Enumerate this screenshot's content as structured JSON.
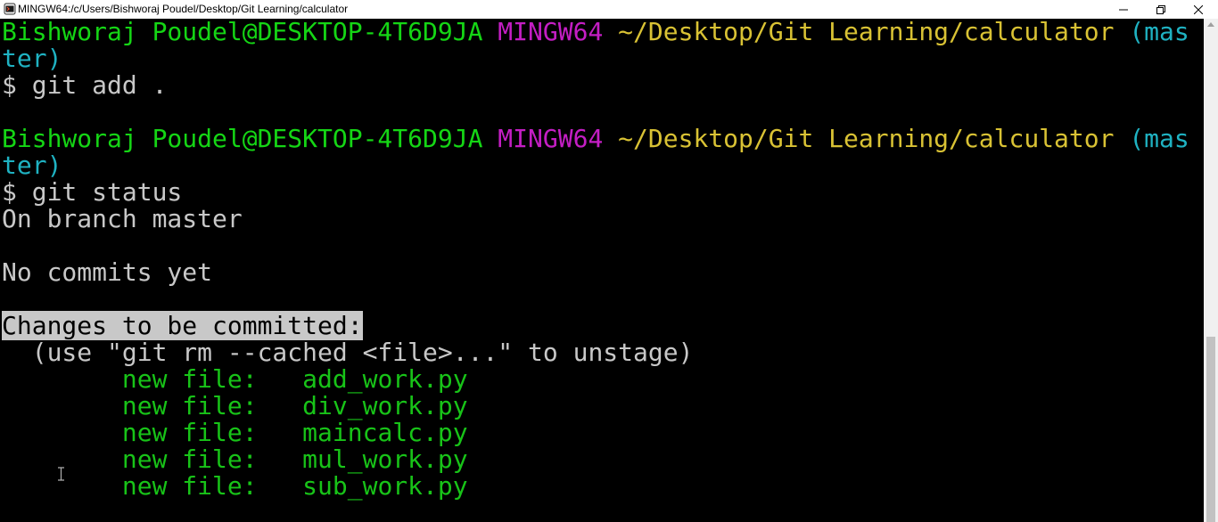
{
  "window": {
    "title": "MINGW64:/c/Users/Bishworaj Poudel/Desktop/Git Learning/calculator",
    "icon": "git-bash-icon",
    "controls": {
      "minimize": "minimize-icon",
      "maximize": "restore-icon",
      "close": "close-icon"
    }
  },
  "colors": {
    "background": "#000000",
    "user_host": "#15d615",
    "shell_env": "#c41ec4",
    "path": "#d9c234",
    "branch": "#1fb2c2",
    "text": "#c8c8c8",
    "staged_files": "#18c318"
  },
  "terminal": {
    "prompt1": {
      "user": "Bishworaj Poudel@DESKTOP-4T6D9JA",
      "env": "MINGW64",
      "path": "~/Desktop/Git Learning/calculator",
      "branch_start": "(mas",
      "branch_end": "ter)",
      "command": "$ git add ."
    },
    "prompt2": {
      "user": "Bishworaj Poudel@DESKTOP-4T6D9JA",
      "env": "MINGW64",
      "path": "~/Desktop/Git Learning/calculator",
      "branch_start": "(mas",
      "branch_end": "ter)",
      "command": "$ git status"
    },
    "output": {
      "branch_line": "On branch master",
      "commits_line": "No commits yet",
      "changes_header": "Changes to be committed:",
      "hint": "  (use \"git rm --cached <file>...\" to unstage)",
      "files": [
        {
          "status": "new file:",
          "name": "add_work.py"
        },
        {
          "status": "new file:",
          "name": "div_work.py"
        },
        {
          "status": "new file:",
          "name": "maincalc.py"
        },
        {
          "status": "new file:",
          "name": "mul_work.py"
        },
        {
          "status": "new file:",
          "name": "sub_work.py"
        }
      ]
    }
  }
}
